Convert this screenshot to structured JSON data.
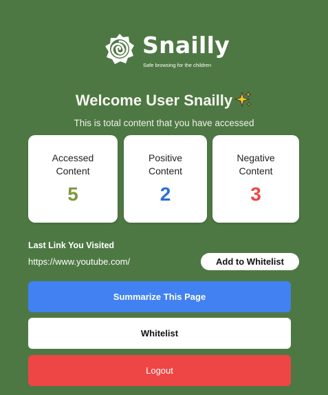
{
  "brand": {
    "name": "Snailly",
    "tagline": "Safe browsing for the children",
    "icon": "snail-shell-logo-icon"
  },
  "welcome": {
    "title": "Welcome User Snailly",
    "emoji_icon": "sparkles-icon",
    "subtitle": "This is total content that you have accessed"
  },
  "stats": [
    {
      "label_line1": "Accessed",
      "label_line2": "Content",
      "value": "5",
      "color": "#7d9a3a"
    },
    {
      "label_line1": "Positive",
      "label_line2": "Content",
      "value": "2",
      "color": "#2a6fd6"
    },
    {
      "label_line1": "Negative",
      "label_line2": "Content",
      "value": "3",
      "color": "#ee4545"
    }
  ],
  "last_link": {
    "title": "Last Link You Visited",
    "url": "https://www.youtube.com/",
    "add_whitelist_label": "Add to Whitelist"
  },
  "actions": {
    "summarize_label": "Summarize This Page",
    "whitelist_label": "Whitelist",
    "logout_label": "Logout"
  },
  "colors": {
    "background": "#4e7843",
    "primary_button": "#4181f1",
    "danger_button": "#ee4545"
  }
}
